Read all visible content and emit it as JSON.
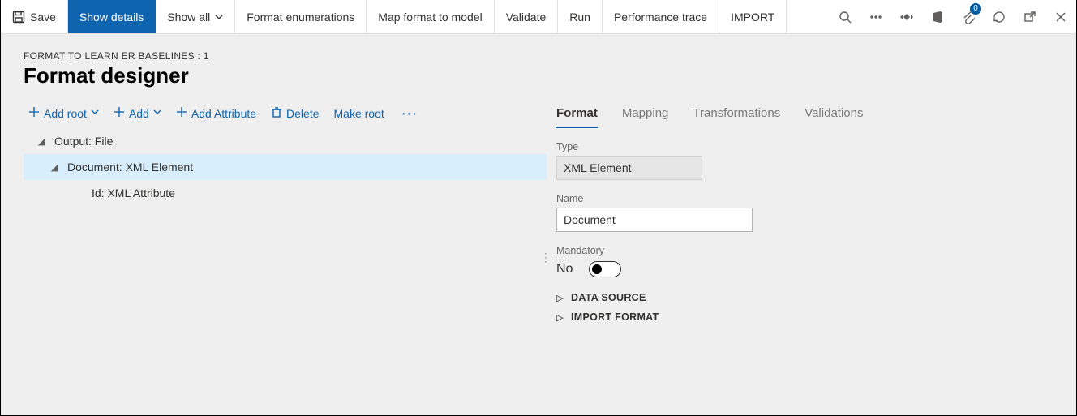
{
  "commandBar": {
    "save": "Save",
    "showDetails": "Show details",
    "showAll": "Show all",
    "formatEnum": "Format enumerations",
    "mapFormat": "Map format to model",
    "validate": "Validate",
    "run": "Run",
    "perfTrace": "Performance trace",
    "import": "IMPORT",
    "badgeCount": "0"
  },
  "breadcrumb": "FORMAT TO LEARN ER BASELINES : 1",
  "pageTitle": "Format designer",
  "treeToolbar": {
    "addRoot": "Add root",
    "add": "Add",
    "addAttribute": "Add Attribute",
    "delete": "Delete",
    "makeRoot": "Make root"
  },
  "tree": {
    "n0": "Output: File",
    "n1": "Document: XML Element",
    "n2": "Id: XML Attribute"
  },
  "tabs": {
    "format": "Format",
    "mapping": "Mapping",
    "transformations": "Transformations",
    "validations": "Validations"
  },
  "formatPane": {
    "typeLabel": "Type",
    "typeValue": "XML Element",
    "nameLabel": "Name",
    "nameValue": "Document",
    "mandatoryLabel": "Mandatory",
    "mandatoryValue": "No",
    "dataSource": "DATA SOURCE",
    "importFormat": "IMPORT FORMAT"
  }
}
